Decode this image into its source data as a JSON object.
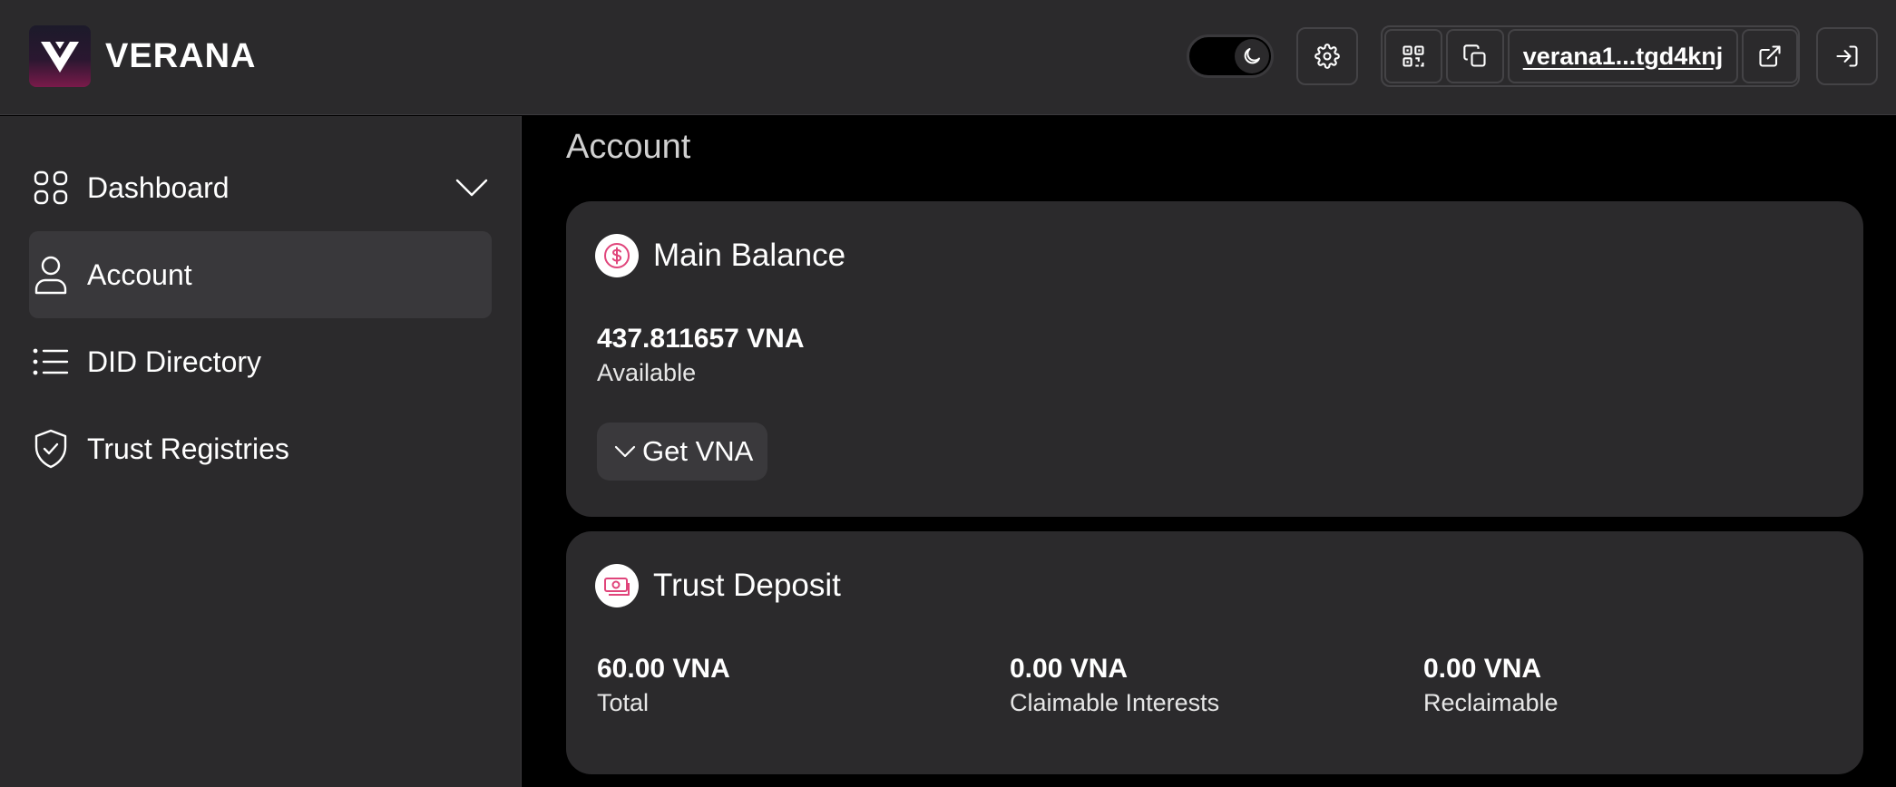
{
  "header": {
    "brand": "VERANA",
    "wallet_address": "verana1...tgd4knj"
  },
  "sidebar": {
    "items": [
      {
        "label": "Dashboard",
        "icon": "grid-icon",
        "active": false
      },
      {
        "label": "Account",
        "icon": "user-icon",
        "active": true
      },
      {
        "label": "DID Directory",
        "icon": "list-icon",
        "active": false
      },
      {
        "label": "Trust Registries",
        "icon": "shield-check-icon",
        "active": false
      }
    ]
  },
  "main": {
    "page_title": "Account",
    "main_balance": {
      "title": "Main Balance",
      "amount": "437.811657 VNA",
      "amount_label": "Available",
      "get_button_label": "Get VNA"
    },
    "trust_deposit": {
      "title": "Trust Deposit",
      "stats": [
        {
          "value": "60.00 VNA",
          "label": "Total"
        },
        {
          "value": "0.00 VNA",
          "label": "Claimable Interests"
        },
        {
          "value": "0.00 VNA",
          "label": "Reclaimable"
        }
      ]
    }
  },
  "colors": {
    "background": "#000000",
    "panel": "#2b2a2c",
    "active_nav": "#39383b",
    "accent_pink": "#e0457b"
  }
}
